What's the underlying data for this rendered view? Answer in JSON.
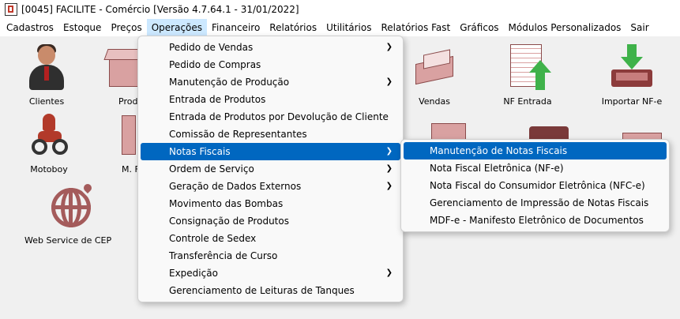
{
  "window": {
    "title": "[0045] FACILITE - Comércio [Versão 4.7.64.1 - 31/01/2022]"
  },
  "menubar": {
    "items": [
      "Cadastros",
      "Estoque",
      "Preços",
      "Operações",
      "Financeiro",
      "Relatórios",
      "Utilitários",
      "Relatórios Fast",
      "Gráficos",
      "Módulos Personalizados",
      "Sair"
    ],
    "active": "Operações"
  },
  "desktop": {
    "tiles": [
      {
        "label": "Clientes",
        "icon": "client-person-icon"
      },
      {
        "label": "Prod",
        "icon": "products-box-icon"
      },
      {
        "label": "Motoboy",
        "icon": "motoboy-icon"
      },
      {
        "label": "M. F",
        "icon": "document-icon"
      },
      {
        "label": "Web Service de CEP",
        "icon": "globe-pin-icon"
      },
      {
        "label": "Vendas",
        "icon": "cash-register-icon"
      },
      {
        "label": "NF Entrada",
        "icon": "nf-entrada-icon"
      },
      {
        "label": "Importar NF-e",
        "icon": "import-tray-icon"
      }
    ]
  },
  "operacoes_menu": {
    "items": [
      {
        "label": "Pedido de Vendas",
        "submenu": true
      },
      {
        "label": "Pedido de Compras",
        "submenu": false
      },
      {
        "label": "Manutenção de Produção",
        "submenu": true
      },
      {
        "label": "Entrada de Produtos",
        "submenu": false
      },
      {
        "label": "Entrada de Produtos por Devolução de Cliente",
        "submenu": false
      },
      {
        "label": "Comissão de Representantes",
        "submenu": false
      },
      {
        "label": "Notas Fiscais",
        "submenu": true,
        "selected": true
      },
      {
        "label": "Ordem de Serviço",
        "submenu": true
      },
      {
        "label": "Geração de Dados Externos",
        "submenu": true
      },
      {
        "label": "Movimento das Bombas",
        "submenu": false
      },
      {
        "label": "Consignação de Produtos",
        "submenu": false
      },
      {
        "label": "Controle de Sedex",
        "submenu": false
      },
      {
        "label": "Transferência de Curso",
        "submenu": false
      },
      {
        "label": "Expedição",
        "submenu": true
      },
      {
        "label": "Gerenciamento de Leituras de Tanques",
        "submenu": false
      }
    ]
  },
  "notas_fiscais_submenu": {
    "items": [
      {
        "label": "Manutenção de Notas Fiscais",
        "selected": true
      },
      {
        "label": "Nota Fiscal Eletrônica (NF-e)"
      },
      {
        "label": "Nota Fiscal do Consumidor Eletrônica (NFC-e)"
      },
      {
        "label": "Gerenciamento de Impressão de Notas Fiscais"
      },
      {
        "label": "MDF-e - Manifesto Eletrônico de Documentos"
      }
    ]
  },
  "colors": {
    "selection": "#0067c0",
    "menubar_active": "#cce8ff",
    "icon_accent": "#a45b5b",
    "arrow_green": "#3fb24a"
  }
}
